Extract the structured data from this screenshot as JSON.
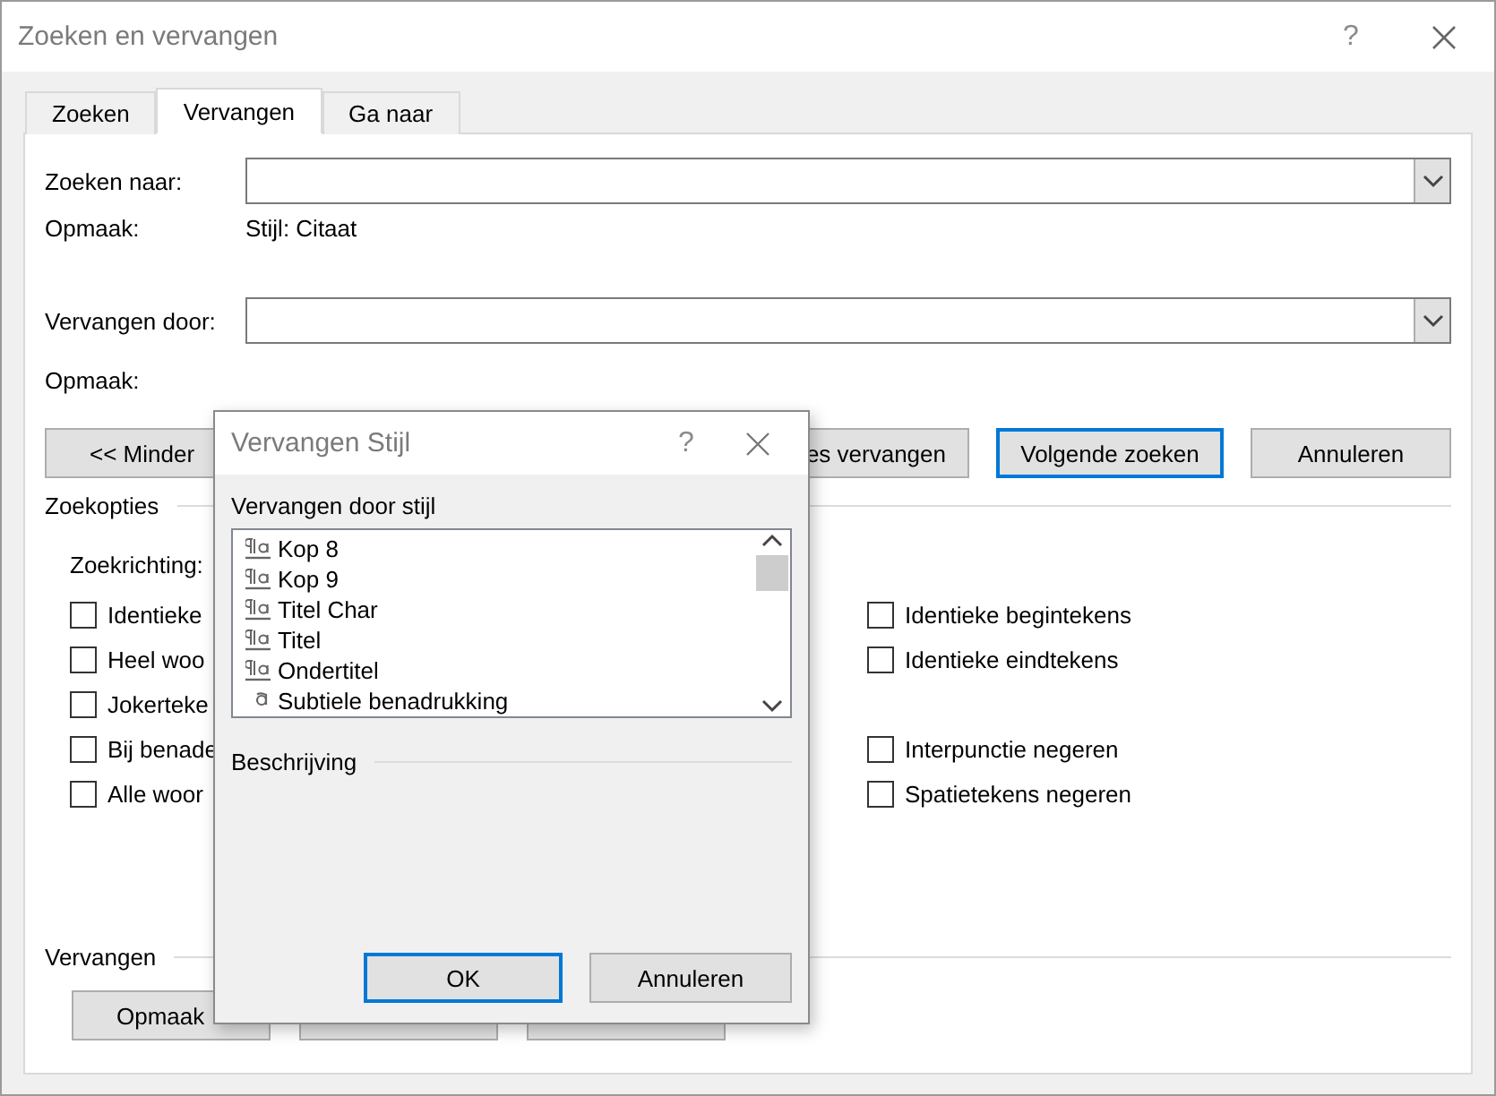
{
  "window": {
    "title": "Zoeken en vervangen",
    "help": "?"
  },
  "tabs": [
    {
      "label": "Zoeken",
      "selected": false
    },
    {
      "label": "Vervangen",
      "selected": true
    },
    {
      "label": "Ga naar",
      "selected": false
    }
  ],
  "find": {
    "label": "Zoeken naar:",
    "format_label": "Opmaak:",
    "format_value": "Stijl: Citaat"
  },
  "replace": {
    "label": "Vervangen door:",
    "format_label": "Opmaak:"
  },
  "action_buttons": [
    {
      "label": "<< Minder",
      "kind": "less"
    },
    {
      "label": "es vervangen",
      "kind": "covered"
    },
    {
      "label": "Volgende zoeken",
      "kind": "default"
    },
    {
      "label": "Annuleren",
      "kind": "plain"
    }
  ],
  "search_options": {
    "title": "Zoekopties",
    "direction_label": "Zoekrichting:",
    "left_options": [
      {
        "label": "Identieke",
        "checked": false
      },
      {
        "label": "Heel woo",
        "checked": false
      },
      {
        "label": "Jokerteke",
        "checked": false
      },
      {
        "label": "Bij benade",
        "checked": false
      },
      {
        "label": "Alle woor",
        "checked": false
      }
    ],
    "right_groups": [
      {
        "options": [
          {
            "label": "Identieke begintekens",
            "checked": false
          },
          {
            "label": "Identieke eindtekens",
            "checked": false
          }
        ]
      },
      {
        "options": [
          {
            "label": "Interpunctie negeren",
            "checked": false
          },
          {
            "label": "Spatietekens negeren",
            "checked": false
          }
        ]
      }
    ]
  },
  "replace_section": {
    "title": "Vervangen",
    "buttons": [
      {
        "kind": "labeled",
        "label": "Opmaak"
      },
      {
        "kind": "covered"
      },
      {
        "kind": "covered"
      }
    ]
  },
  "style_dialog": {
    "title": "Vervangen Stijl",
    "help": "?",
    "list_label": "Vervangen door stijl",
    "styles": [
      {
        "name": "Kop 8",
        "kind": "paragraph"
      },
      {
        "name": "Kop 9",
        "kind": "paragraph"
      },
      {
        "name": "Titel Char",
        "kind": "paragraph"
      },
      {
        "name": "Titel",
        "kind": "paragraph"
      },
      {
        "name": "Ondertitel",
        "kind": "paragraph"
      },
      {
        "name": "Subtiele benadrukking",
        "kind": "character"
      }
    ],
    "description_label": "Beschrijving",
    "buttons": [
      {
        "label": "OK",
        "kind": "default"
      },
      {
        "label": "Annuleren",
        "kind": "plain"
      }
    ]
  }
}
